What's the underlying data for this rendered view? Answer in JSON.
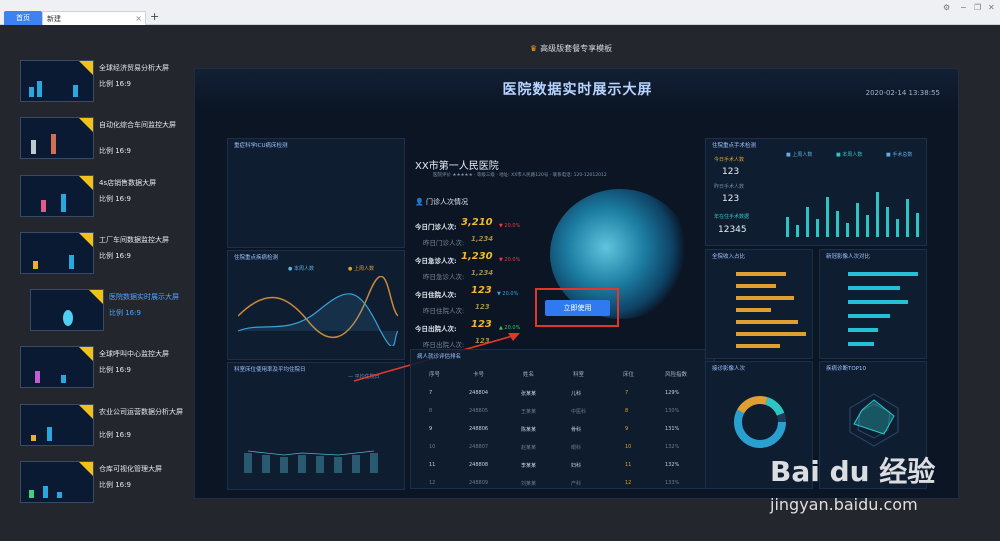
{
  "tabs": {
    "home": "首页",
    "new": "新建",
    "close": "×",
    "add": "+"
  },
  "window_controls": [
    "⚙",
    "−",
    "❐",
    "✕"
  ],
  "banner": {
    "crown": "♛",
    "text": "高级版套餐专享模板"
  },
  "templates": [
    {
      "title": "全球经济贸易分析大屏",
      "ratio": "比例 16:9"
    },
    {
      "title": "自动化综合车间监控大屏",
      "ratio": "比例 16:9"
    },
    {
      "title": "4s店销售数据大屏",
      "ratio": "比例 16:9"
    },
    {
      "title": "工厂车间数据监控大屏",
      "ratio": "比例 16:9"
    },
    {
      "title": "医院数据实时展示大屏",
      "ratio": "比例 16:9"
    },
    {
      "title": "全球呼叫中心监控大屏",
      "ratio": "比例 16:9"
    },
    {
      "title": "农业公司运营数据分析大屏",
      "ratio": "比例 16:9"
    },
    {
      "title": "仓库可视化管理大屏",
      "ratio": "比例 16:9"
    }
  ],
  "preview": {
    "title": "医院数据实时展示大屏",
    "time": "2020-02-14 13:38:55",
    "panels": {
      "icu": "重症科学ICU病床检测",
      "inpatient": "住院重点疾病检测",
      "inpatient_legend_a": "● 本周人数",
      "inpatient_legend_b": "● 上周人数",
      "dept": "科室床位使用率及平均住院日",
      "dept_legend": "— 平均住院日",
      "surgery": "住院重点手术检测",
      "surgery_legend_a": "■ 上周人数",
      "surgery_legend_b": "■ 本周人数",
      "surgery_legend_c": "■ 手术总数",
      "surgery_today_label": "今日手术人数",
      "surgery_today": "123",
      "surgery_done_label": "昨日手术人数",
      "surgery_done": "123",
      "surgery_year_label": "年在住手术数据",
      "surgery_year": "12345",
      "income": "全院收入占比",
      "disease": "新冠影像人次对比",
      "checkup": "接诊影像人次",
      "ranking": "疾病诊断TOP10",
      "patients": "病人就诊评估排名"
    },
    "hospital": {
      "name": "XX市第一人民医院",
      "sub": "医院评价 ★★★★★   · 等级三级  · 地址: XX市人民路120号  · 联系电话: 120-12012012"
    },
    "outpatient_title": "门诊人次情况",
    "stats": [
      {
        "label": "今日门诊人次:",
        "value": "3,210",
        "trend": "▼ 20.0%",
        "dim": false
      },
      {
        "label": "昨日门诊人次:",
        "value": "1,234",
        "trend": "",
        "dim": true
      },
      {
        "label": "今日急诊人次:",
        "value": "1,230",
        "trend": "▼ 20.0%",
        "dim": false
      },
      {
        "label": "昨日急诊人次:",
        "value": "1,234",
        "trend": "",
        "dim": true
      },
      {
        "label": "今日住院人次:",
        "value": "123",
        "trend": "▼ 20.0%",
        "dim": false
      },
      {
        "label": "昨日住院人次:",
        "value": "123",
        "trend": "",
        "dim": true
      },
      {
        "label": "今日出院人次:",
        "value": "123",
        "trend": "▲ 20.0%",
        "dim": false
      },
      {
        "label": "昨日出院人次:",
        "value": "123",
        "trend": "",
        "dim": true
      }
    ],
    "use_button": "立即使用",
    "table": {
      "headers": [
        "序号",
        "卡号",
        "姓名",
        "科室",
        "床位",
        "风险指数"
      ],
      "rows": [
        [
          "7",
          "248804",
          "张某某",
          "儿科",
          "7",
          "129%"
        ],
        [
          "8",
          "248805",
          "王某某",
          "中医科",
          "8",
          "130%"
        ],
        [
          "9",
          "248806",
          "陈某某",
          "骨科",
          "9",
          "131%"
        ],
        [
          "10",
          "248807",
          "赵某某",
          "眼科",
          "10",
          "132%"
        ],
        [
          "11",
          "248808",
          "李某某",
          "妇科",
          "11",
          "132%"
        ],
        [
          "12",
          "248809",
          "刘某某",
          "产科",
          "12",
          "133%"
        ]
      ]
    }
  },
  "watermark": {
    "brand": "Bai du 经验",
    "url": "jingyan.baidu.com"
  }
}
